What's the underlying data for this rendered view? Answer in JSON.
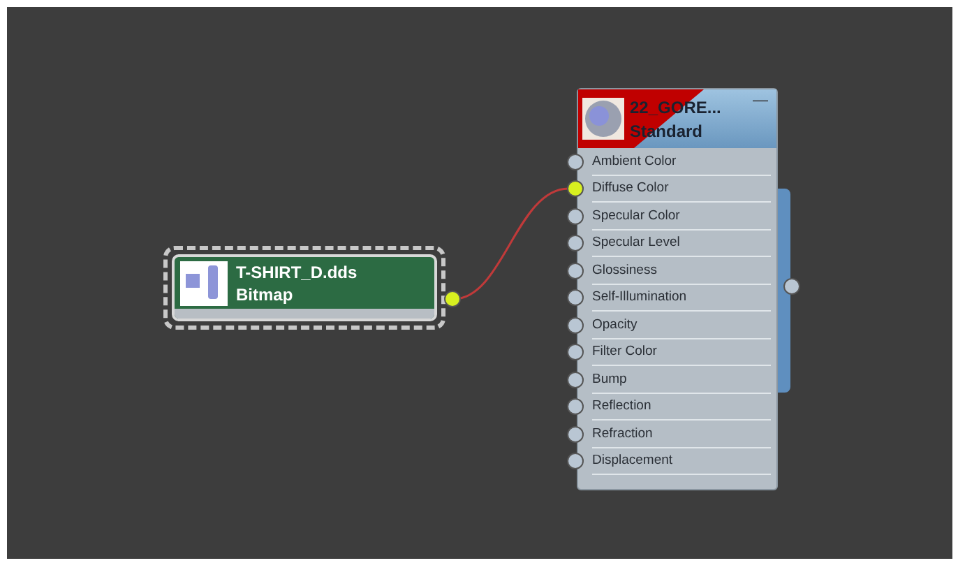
{
  "nodes": [
    {
      "kind": "bitmap",
      "title": "T-SHIRT_D.dds",
      "subtitle": "Bitmap",
      "selected": true
    },
    {
      "kind": "material",
      "title": "22_GORE...",
      "subtitle": "Standard",
      "collapse_button": "—",
      "slots": [
        {
          "label": "Ambient Color",
          "connected": false
        },
        {
          "label": "Diffuse Color",
          "connected": true
        },
        {
          "label": "Specular Color",
          "connected": false
        },
        {
          "label": "Specular Level",
          "connected": false
        },
        {
          "label": "Glossiness",
          "connected": false
        },
        {
          "label": "Self-Illumination",
          "connected": false
        },
        {
          "label": "Opacity",
          "connected": false
        },
        {
          "label": "Filter Color",
          "connected": false
        },
        {
          "label": "Bump",
          "connected": false
        },
        {
          "label": "Reflection",
          "connected": false
        },
        {
          "label": "Refraction",
          "connected": false
        },
        {
          "label": "Displacement",
          "connected": false
        }
      ]
    }
  ]
}
